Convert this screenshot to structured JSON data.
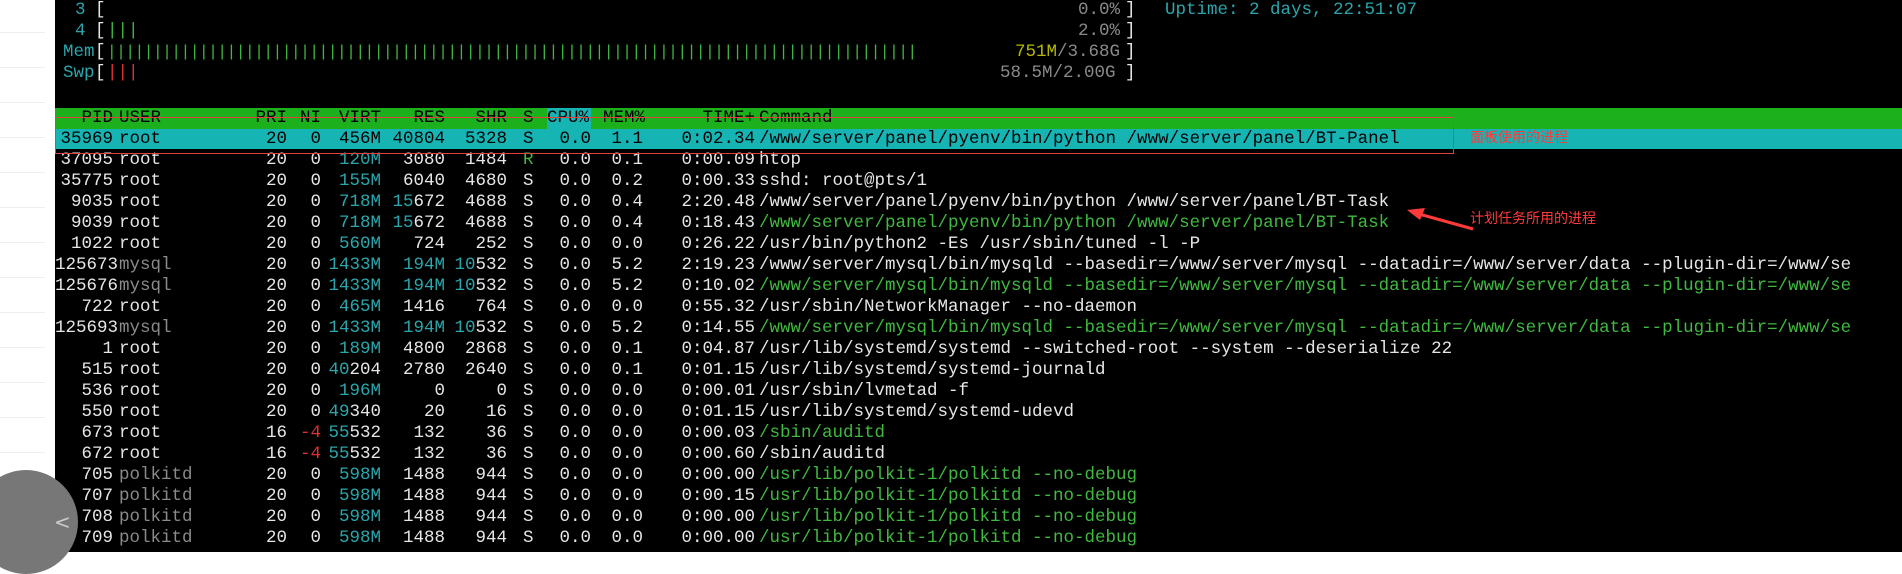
{
  "meters": {
    "cpu3": {
      "num": "3",
      "bar": "",
      "pct": "0.0%"
    },
    "cpu4": {
      "num": "4",
      "bar": "|||",
      "pct": "2.0%"
    },
    "mem": {
      "label": "Mem",
      "bar": "||||||||||||||||||||||||||||||||||||||||||||||||||||||||||||||||||||||||||||||||||||||||",
      "value_a": "751M",
      "value_b": "/3.68G"
    },
    "swp": {
      "label": "Swp",
      "bar": "|||",
      "value": "58.5M/2.00G"
    },
    "uptime": "Uptime: 2 days, 22:51:07"
  },
  "columns": {
    "pid": "PID",
    "user": "USER",
    "pri": "PRI",
    "ni": "NI",
    "virt": "VIRT",
    "res": "RES",
    "shr": "SHR",
    "s": "S",
    "cpu": "CPU%",
    "mem": "MEM%",
    "time": "TIME+",
    "command": "Command"
  },
  "processes": [
    {
      "pid": "35969",
      "user": "root",
      "pri": "20",
      "ni": "0",
      "virt": "456M",
      "res": "40804",
      "shr": "5328",
      "s": "S",
      "cpu": "0.0",
      "mem": "1.1",
      "time": "0:02.34",
      "command": "/www/server/panel/pyenv/bin/python /www/server/panel/BT-Panel"
    },
    {
      "pid": "37095",
      "user": "root",
      "pri": "20",
      "ni": "0",
      "virt": "120M",
      "res": "3080",
      "shr": "1484",
      "s": "R",
      "cpu": "0.0",
      "mem": "0.1",
      "time": "0:00.09",
      "command": "htop"
    },
    {
      "pid": "35775",
      "user": "root",
      "pri": "20",
      "ni": "0",
      "virt": "155M",
      "res": "6040",
      "shr": "4680",
      "s": "S",
      "cpu": "0.0",
      "mem": "0.2",
      "time": "0:00.33",
      "command": "sshd: root@pts/1"
    },
    {
      "pid": "9035",
      "user": "root",
      "pri": "20",
      "ni": "0",
      "virt": "718M",
      "res": "15672",
      "shr": "4688",
      "s": "S",
      "cpu": "0.0",
      "mem": "0.4",
      "time": "2:20.48",
      "command": "/www/server/panel/pyenv/bin/python /www/server/panel/BT-Task"
    },
    {
      "pid": "9039",
      "user": "root",
      "pri": "20",
      "ni": "0",
      "virt": "718M",
      "res": "15672",
      "shr": "4688",
      "s": "S",
      "cpu": "0.0",
      "mem": "0.4",
      "time": "0:18.43",
      "command": "/www/server/panel/pyenv/bin/python /www/server/panel/BT-Task"
    },
    {
      "pid": "1022",
      "user": "root",
      "pri": "20",
      "ni": "0",
      "virt": "560M",
      "res": "724",
      "shr": "252",
      "s": "S",
      "cpu": "0.0",
      "mem": "0.0",
      "time": "0:26.22",
      "command": "/usr/bin/python2 -Es /usr/sbin/tuned -l -P"
    },
    {
      "pid": "125673",
      "user": "mysql",
      "pri": "20",
      "ni": "0",
      "virt": "1433M",
      "res": "194M",
      "shr": "10532",
      "s": "S",
      "cpu": "0.0",
      "mem": "5.2",
      "time": "2:19.23",
      "command": "/www/server/mysql/bin/mysqld --basedir=/www/server/mysql --datadir=/www/server/data --plugin-dir=/www/se"
    },
    {
      "pid": "125676",
      "user": "mysql",
      "pri": "20",
      "ni": "0",
      "virt": "1433M",
      "res": "194M",
      "shr": "10532",
      "s": "S",
      "cpu": "0.0",
      "mem": "5.2",
      "time": "0:10.02",
      "command": "/www/server/mysql/bin/mysqld --basedir=/www/server/mysql --datadir=/www/server/data --plugin-dir=/www/se"
    },
    {
      "pid": "722",
      "user": "root",
      "pri": "20",
      "ni": "0",
      "virt": "465M",
      "res": "1416",
      "shr": "764",
      "s": "S",
      "cpu": "0.0",
      "mem": "0.0",
      "time": "0:55.32",
      "command": "/usr/sbin/NetworkManager --no-daemon"
    },
    {
      "pid": "125693",
      "user": "mysql",
      "pri": "20",
      "ni": "0",
      "virt": "1433M",
      "res": "194M",
      "shr": "10532",
      "s": "S",
      "cpu": "0.0",
      "mem": "5.2",
      "time": "0:14.55",
      "command": "/www/server/mysql/bin/mysqld --basedir=/www/server/mysql --datadir=/www/server/data --plugin-dir=/www/se"
    },
    {
      "pid": "1",
      "user": "root",
      "pri": "20",
      "ni": "0",
      "virt": "189M",
      "res": "4800",
      "shr": "2868",
      "s": "S",
      "cpu": "0.0",
      "mem": "0.1",
      "time": "0:04.87",
      "command": "/usr/lib/systemd/systemd --switched-root --system --deserialize 22"
    },
    {
      "pid": "515",
      "user": "root",
      "pri": "20",
      "ni": "0",
      "virt": "40204",
      "res": "2780",
      "shr": "2640",
      "s": "S",
      "cpu": "0.0",
      "mem": "0.1",
      "time": "0:01.15",
      "command": "/usr/lib/systemd/systemd-journald"
    },
    {
      "pid": "536",
      "user": "root",
      "pri": "20",
      "ni": "0",
      "virt": "196M",
      "res": "0",
      "shr": "0",
      "s": "S",
      "cpu": "0.0",
      "mem": "0.0",
      "time": "0:00.01",
      "command": "/usr/sbin/lvmetad -f"
    },
    {
      "pid": "550",
      "user": "root",
      "pri": "20",
      "ni": "0",
      "virt": "49340",
      "res": "20",
      "shr": "16",
      "s": "S",
      "cpu": "0.0",
      "mem": "0.0",
      "time": "0:01.15",
      "command": "/usr/lib/systemd/systemd-udevd"
    },
    {
      "pid": "673",
      "user": "root",
      "pri": "16",
      "ni": "-4",
      "virt": "55532",
      "res": "132",
      "shr": "36",
      "s": "S",
      "cpu": "0.0",
      "mem": "0.0",
      "time": "0:00.03",
      "command": "/sbin/auditd"
    },
    {
      "pid": "672",
      "user": "root",
      "pri": "16",
      "ni": "-4",
      "virt": "55532",
      "res": "132",
      "shr": "36",
      "s": "S",
      "cpu": "0.0",
      "mem": "0.0",
      "time": "0:00.60",
      "command": "/sbin/auditd"
    },
    {
      "pid": "705",
      "user": "polkitd",
      "pri": "20",
      "ni": "0",
      "virt": "598M",
      "res": "1488",
      "shr": "944",
      "s": "S",
      "cpu": "0.0",
      "mem": "0.0",
      "time": "0:00.00",
      "command": "/usr/lib/polkit-1/polkitd --no-debug"
    },
    {
      "pid": "707",
      "user": "polkitd",
      "pri": "20",
      "ni": "0",
      "virt": "598M",
      "res": "1488",
      "shr": "944",
      "s": "S",
      "cpu": "0.0",
      "mem": "0.0",
      "time": "0:00.15",
      "command": "/usr/lib/polkit-1/polkitd --no-debug"
    },
    {
      "pid": "708",
      "user": "polkitd",
      "pri": "20",
      "ni": "0",
      "virt": "598M",
      "res": "1488",
      "shr": "944",
      "s": "S",
      "cpu": "0.0",
      "mem": "0.0",
      "time": "0:00.00",
      "command": "/usr/lib/polkit-1/polkitd --no-debug"
    },
    {
      "pid": "709",
      "user": "polkitd",
      "pri": "20",
      "ni": "0",
      "virt": "598M",
      "res": "1488",
      "shr": "944",
      "s": "S",
      "cpu": "0.0",
      "mem": "0.0",
      "time": "0:00.00",
      "command": "/usr/lib/polkit-1/polkitd --no-debug"
    }
  ],
  "annotations": {
    "panel_process": "面板使用的进程",
    "task_process": "计划任务所用的进程"
  },
  "icons": {
    "back": "chevron-left-icon"
  },
  "colors": {
    "header_bg": "#1cb01c",
    "selected_bg": "#17b4b4",
    "annotation": "#ff3a3a"
  }
}
